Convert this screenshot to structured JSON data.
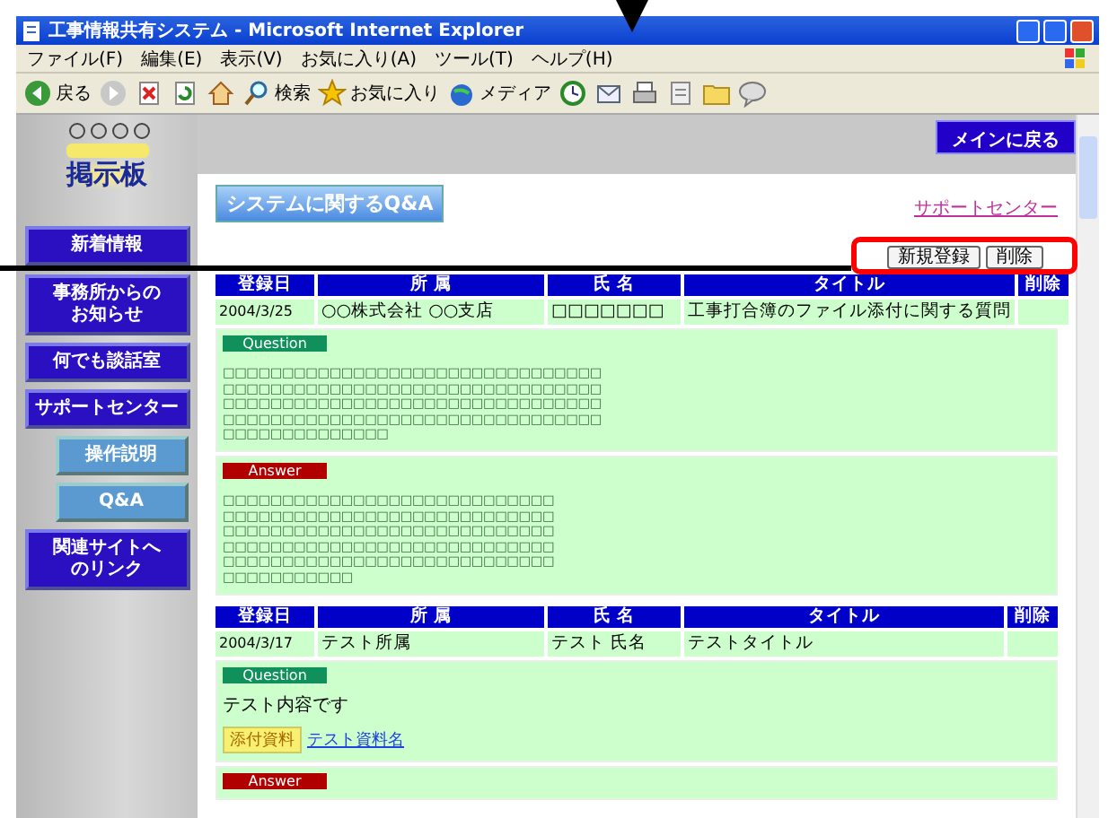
{
  "window": {
    "title": "工事情報共有システム - Microsoft Internet Explorer",
    "menu": [
      "ファイル(F)",
      "編集(E)",
      "表示(V)",
      "お気に入り(A)",
      "ツール(T)",
      "ヘルプ(H)"
    ],
    "toolbar": [
      {
        "kind": "back",
        "label": "戻る"
      },
      {
        "kind": "forward"
      },
      {
        "kind": "stop"
      },
      {
        "kind": "refresh"
      },
      {
        "kind": "home"
      },
      {
        "kind": "search",
        "label": "検索"
      },
      {
        "kind": "favorites",
        "label": "お気に入り"
      },
      {
        "kind": "media",
        "label": "メディア"
      },
      {
        "kind": "history"
      },
      {
        "kind": "mail"
      },
      {
        "kind": "print"
      },
      {
        "kind": "edit"
      },
      {
        "kind": "folder"
      },
      {
        "kind": "messenger"
      }
    ]
  },
  "header": {
    "main_button": "メインに戻る",
    "logo_caption": "掲示板"
  },
  "sidebar": {
    "items": [
      {
        "kind": "main",
        "label": "新着情報"
      },
      {
        "kind": "main",
        "label": "事務所からのお知らせ"
      },
      {
        "kind": "main",
        "label": "何でも談話室"
      },
      {
        "kind": "main",
        "label": "サポートセンター"
      },
      {
        "kind": "sub",
        "label": "操作説明"
      },
      {
        "kind": "sub",
        "label": "Q&A"
      },
      {
        "kind": "main",
        "label": "関連サイトへのリンク"
      }
    ]
  },
  "content": {
    "heading": "システムに関するQ&A",
    "link": "サポートセンター",
    "buttons": [
      "新規登録",
      "削除"
    ],
    "entries": [
      {
        "columns": [
          "登録日",
          "所 属",
          "氏 名",
          "タイトル",
          "削除"
        ],
        "cells": [
          "2004/3/25",
          "○○株式会社 ○○支店",
          "□□□□□□□",
          "工事打合簿のファイル添付に関する質問",
          ""
        ],
        "question": {
          "label": "Question",
          "lines": [
            "□□□□□□□□□□□□□□□□□□□□□□□□□□□□□□□□",
            "□□□□□□□□□□□□□□□□□□□□□□□□□□□□□□□□",
            "□□□□□□□□□□□□□□□□□□□□□□□□□□□□□□□□",
            "□□□□□□□□□□□□□□□□□□□□□□□□□□□□□□□□",
            "□□□□□□□□□□□□□□"
          ]
        },
        "answer": {
          "label": "Answer",
          "lines": [
            "□□□□□□□□□□□□□□□□□□□□□□□□□□□□",
            "□□□□□□□□□□□□□□□□□□□□□□□□□□□□",
            "□□□□□□□□□□□□□□□□□□□□□□□□□□□□",
            "□□□□□□□□□□□□□□□□□□□□□□□□□□□□",
            "□□□□□□□□□□□□□□□□□□□□□□□□□□□□",
            "□□□□□□□□□□□"
          ]
        }
      },
      {
        "columns": [
          "登録日",
          "所 属",
          "氏 名",
          "タイトル",
          "削除"
        ],
        "cells": [
          "2004/3/17",
          "テスト所属",
          "テスト 氏名",
          "テストタイトル",
          ""
        ],
        "question": {
          "label": "Question",
          "lines": [
            "テスト内容です"
          ],
          "attachment": {
            "label": "添付資料",
            "link": "テスト資料名"
          }
        },
        "answer": {
          "label": "Answer"
        }
      }
    ]
  }
}
